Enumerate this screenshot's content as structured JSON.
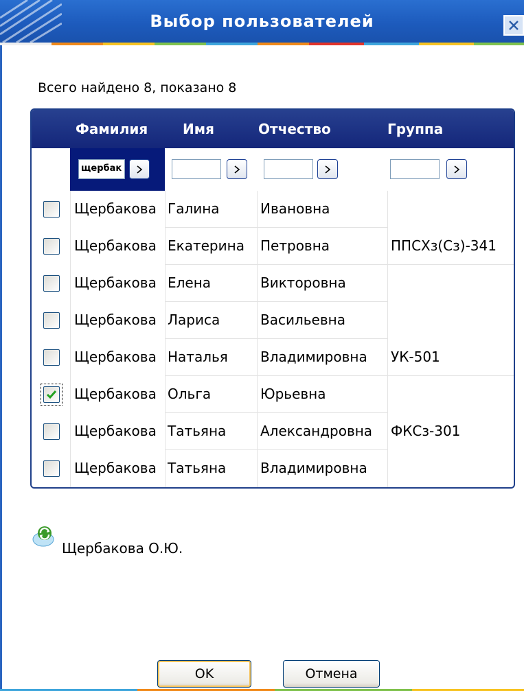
{
  "window": {
    "title": "Выбор пользователей",
    "close_symbol": "✕"
  },
  "summary": "Всего найдено 8, показано 8",
  "table": {
    "columns": [
      "Фамилия",
      "Имя",
      "Отчество",
      "Группа"
    ],
    "filters": [
      {
        "value": "щербак",
        "placeholder": ""
      },
      {
        "value": "",
        "placeholder": ""
      },
      {
        "value": "",
        "placeholder": ""
      },
      {
        "value": "",
        "placeholder": ""
      }
    ],
    "filter_go_label": ">",
    "rows": [
      {
        "checked": false,
        "last": "Щербакова",
        "first": "Галина",
        "middle": "Ивановна",
        "group": ""
      },
      {
        "checked": false,
        "last": "Щербакова",
        "first": "Екатерина",
        "middle": "Петровна",
        "group": "ППСХз(Сз)-341"
      },
      {
        "checked": false,
        "last": "Щербакова",
        "first": "Елена",
        "middle": "Викторовна",
        "group": ""
      },
      {
        "checked": false,
        "last": "Щербакова",
        "first": "Лариса",
        "middle": "Васильевна",
        "group": ""
      },
      {
        "checked": false,
        "last": "Щербакова",
        "first": "Наталья",
        "middle": "Владимировна",
        "group": "УК-501"
      },
      {
        "checked": true,
        "last": "Щербакова",
        "first": "Ольга",
        "middle": "Юрьевна",
        "group": ""
      },
      {
        "checked": false,
        "last": "Щербакова",
        "first": "Татьяна",
        "middle": "Александровна",
        "group": "ФКСз-301"
      },
      {
        "checked": false,
        "last": "Щербакова",
        "first": "Татьяна",
        "middle": "Владимировна",
        "group": ""
      }
    ]
  },
  "selected_user": "Щербакова О.Ю.",
  "buttons": {
    "ok": "OK",
    "cancel": "Отмена"
  },
  "colors": {
    "title_bar": "#1d5bbd",
    "grid_header": "#14267a",
    "active_filter": "#061a7a",
    "check_mark": "#21a121"
  },
  "icons": {
    "close": "close-icon",
    "filter_go": "chevron-right-icon",
    "checkbox_checked": "check-icon",
    "user_refresh": "refresh-user-icon"
  }
}
